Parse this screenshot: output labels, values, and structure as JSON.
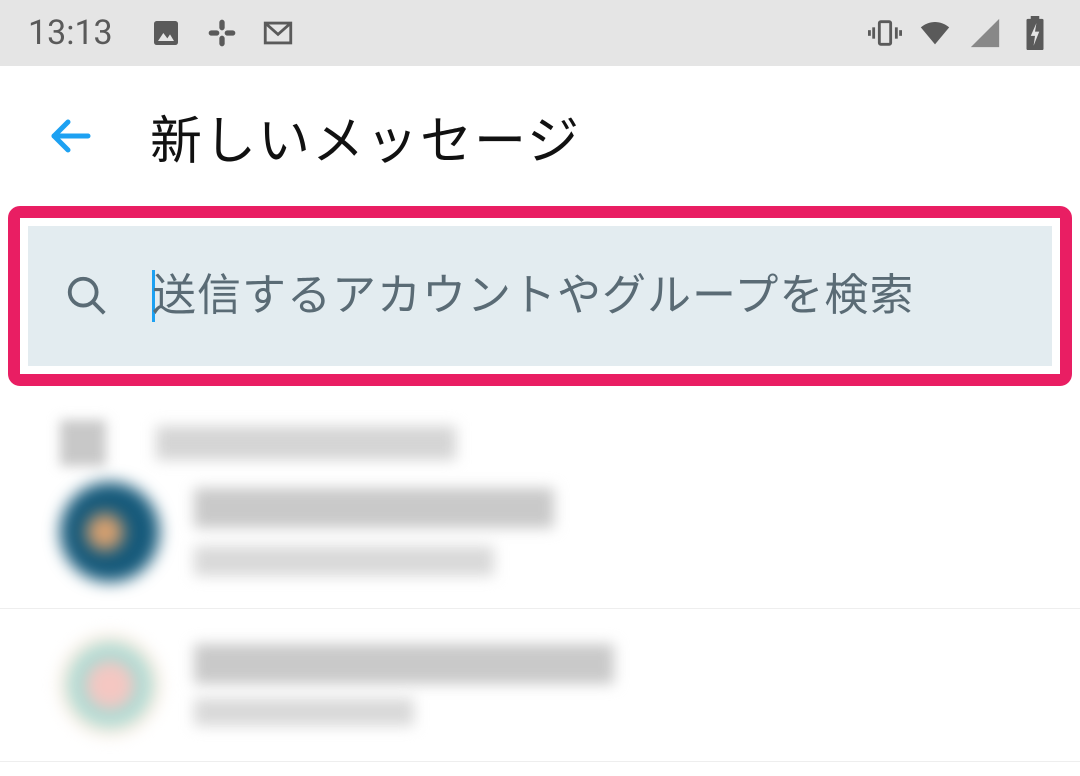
{
  "statusbar": {
    "time": "13:13",
    "icons_left": [
      "image-icon",
      "slack-icon",
      "gmail-icon"
    ],
    "icons_right": [
      "vibrate-icon",
      "wifi-icon",
      "cellular-icon",
      "battery-charging-icon"
    ]
  },
  "header": {
    "back_label": "戻る",
    "title": "新しいメッセージ"
  },
  "search": {
    "placeholder": "送信するアカウントやグループを検索"
  },
  "accent_color": "#1da1f2",
  "highlight_color": "#e91e63"
}
